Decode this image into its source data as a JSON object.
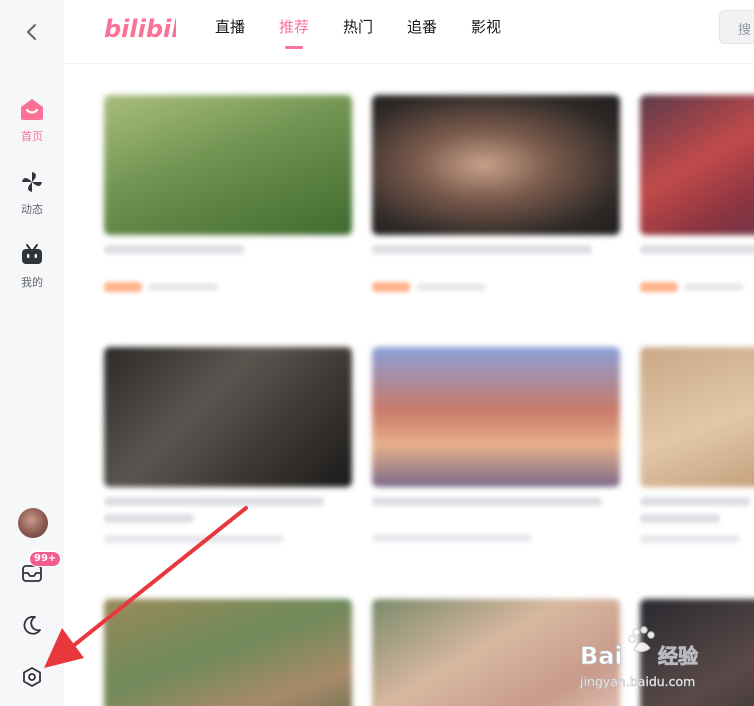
{
  "header": {
    "logo_text": "bilibili",
    "tabs": [
      {
        "label": "直播"
      },
      {
        "label": "推荐"
      },
      {
        "label": "热门"
      },
      {
        "label": "追番"
      },
      {
        "label": "影视"
      }
    ],
    "active_tab": "推荐",
    "search_placeholder": "搜"
  },
  "sidebar": {
    "items": [
      {
        "label": "首页",
        "icon": "home-tv-icon",
        "active": true
      },
      {
        "label": "动态",
        "icon": "pinwheel-icon",
        "active": false
      },
      {
        "label": "我的",
        "icon": "bilibili-tv-icon",
        "active": false
      }
    ],
    "message_badge": "99+",
    "bottom_icons": [
      "avatar",
      "message-icon",
      "moon-icon",
      "settings-icon"
    ]
  },
  "feed": {
    "cards": [
      {
        "thumb": "green-field",
        "tag": true
      },
      {
        "thumb": "face-portrait",
        "tag": true
      },
      {
        "thumb": "red-scene",
        "tag": true
      },
      {
        "thumb": "dark-text",
        "tag": false
      },
      {
        "thumb": "anime-sunset",
        "tag": false
      },
      {
        "thumb": "warm-beige",
        "tag": false
      },
      {
        "thumb": "green-room",
        "tag": false
      },
      {
        "thumb": "skin-tones",
        "tag": false
      },
      {
        "thumb": "dark-figure",
        "tag": false
      }
    ]
  },
  "watermark": {
    "brand": "Bai",
    "brand_suffix": "经验",
    "url": "jingyan.baidu.com"
  },
  "colors": {
    "accent": "#fb7299",
    "sidebar_bg": "#f6f7f8",
    "badge": "#f25d8e",
    "arrow": "#e8383d"
  }
}
